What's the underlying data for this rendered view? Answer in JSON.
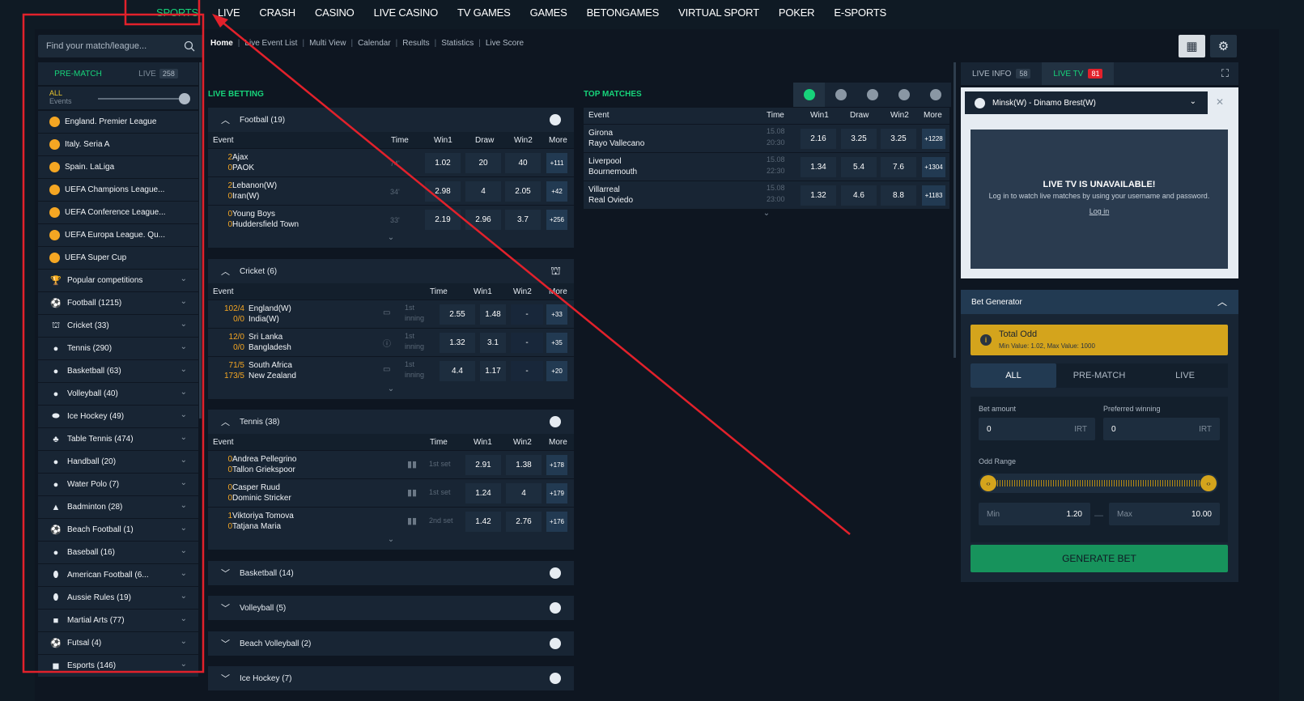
{
  "topnav": [
    "SPORTS",
    "LIVE",
    "CRASH",
    "CASINO",
    "LIVE CASINO",
    "TV GAMES",
    "GAMES",
    "BETONGAMES",
    "VIRTUAL SPORT",
    "POKER",
    "E-SPORTS"
  ],
  "search": {
    "placeholder": "Find your match/league..."
  },
  "sidebar": {
    "tabs": [
      {
        "label": "PRE-MATCH"
      },
      {
        "label": "LIVE",
        "count": "258"
      }
    ],
    "all_label": "ALL",
    "events_label": "Events",
    "items": [
      {
        "label": "England. Premier League",
        "icon": "football",
        "chev": false
      },
      {
        "label": "Italy. Seria A",
        "icon": "football",
        "chev": false
      },
      {
        "label": "Spain. LaLiga",
        "icon": "football",
        "chev": false
      },
      {
        "label": "UEFA Champions League...",
        "icon": "football",
        "chev": false
      },
      {
        "label": "UEFA Conference League...",
        "icon": "football",
        "chev": false
      },
      {
        "label": "UEFA Europa League. Qu...",
        "icon": "football",
        "chev": false
      },
      {
        "label": "UEFA Super Cup",
        "icon": "football",
        "chev": false
      },
      {
        "label": "Popular competitions",
        "icon": "podium",
        "chev": true
      },
      {
        "label": "Football (1215)",
        "icon": "soccer",
        "chev": true
      },
      {
        "label": "Cricket (33)",
        "icon": "cricket",
        "chev": true
      },
      {
        "label": "Tennis (290)",
        "icon": "tennis",
        "chev": true
      },
      {
        "label": "Basketball (63)",
        "icon": "basketball",
        "chev": true
      },
      {
        "label": "Volleyball (40)",
        "icon": "volleyball",
        "chev": true
      },
      {
        "label": "Ice Hockey (49)",
        "icon": "puck",
        "chev": true
      },
      {
        "label": "Table Tennis (474)",
        "icon": "paddle",
        "chev": true
      },
      {
        "label": "Handball (20)",
        "icon": "handball",
        "chev": true
      },
      {
        "label": "Water Polo (7)",
        "icon": "waterpolo",
        "chev": true
      },
      {
        "label": "Badminton (28)",
        "icon": "shuttle",
        "chev": true
      },
      {
        "label": "Beach Football (1)",
        "icon": "soccer",
        "chev": true
      },
      {
        "label": "Baseball (16)",
        "icon": "baseball",
        "chev": true
      },
      {
        "label": "American Football (6...",
        "icon": "amfootball",
        "chev": true
      },
      {
        "label": "Aussie Rules (19)",
        "icon": "aussie",
        "chev": true
      },
      {
        "label": "Martial Arts (77)",
        "icon": "glove",
        "chev": true
      },
      {
        "label": "Futsal (4)",
        "icon": "soccer",
        "chev": true
      },
      {
        "label": "Esports (146)",
        "icon": "gamepad",
        "chev": true
      }
    ]
  },
  "subnav": [
    "Home",
    "Live Event List",
    "Multi View",
    "Calendar",
    "Results",
    "Statistics",
    "Live Score"
  ],
  "live_betting": {
    "title": "LIVE BETTING",
    "football": {
      "label": "Football  (19)",
      "headers": {
        "event": "Event",
        "time": "Time",
        "w1": "Win1",
        "draw": "Draw",
        "w2": "Win2",
        "more": "More"
      },
      "rows": [
        {
          "s1": "2",
          "t1": "Ajax",
          "s2": "0",
          "t2": "PAOK",
          "time": "74'",
          "o1": "1.02",
          "o2": "20",
          "o3": "40",
          "more": "+111"
        },
        {
          "s1": "2",
          "t1": "Lebanon(W)",
          "s2": "0",
          "t2": "Iran(W)",
          "time": "34'",
          "o1": "2.98",
          "o2": "4",
          "o3": "2.05",
          "more": "+42"
        },
        {
          "s1": "0",
          "t1": "Young Boys",
          "s2": "0",
          "t2": "Huddersfield Town",
          "time": "33'",
          "o1": "2.19",
          "o2": "2.96",
          "o3": "3.7",
          "more": "+256"
        }
      ]
    },
    "cricket": {
      "label": "Cricket  (6)",
      "headers": {
        "event": "Event",
        "time": "Time",
        "w1": "Win1",
        "w2": "Win2",
        "more": "More"
      },
      "rows": [
        {
          "s1": "102/4",
          "t1": "England(W)",
          "s2": "0/0",
          "t2": "India(W)",
          "time1": "1st",
          "time2": "inning",
          "o1": "2.55",
          "o2": "1.48",
          "o3": "-",
          "more": "+33"
        },
        {
          "s1": "12/0",
          "t1": "Sri Lanka",
          "s2": "0/0",
          "t2": "Bangladesh",
          "time1": "1st",
          "time2": "inning",
          "o1": "1.32",
          "o2": "3.1",
          "o3": "-",
          "more": "+35"
        },
        {
          "s1": "71/5",
          "t1": "South Africa",
          "s2": "173/5",
          "t2": "New Zealand",
          "time1": "1st",
          "time2": "inning",
          "o1": "4.4",
          "o2": "1.17",
          "o3": "-",
          "more": "+20"
        }
      ]
    },
    "tennis": {
      "label": "Tennis  (38)",
      "headers": {
        "event": "Event",
        "time": "Time",
        "w1": "Win1",
        "w2": "Win2",
        "more": "More"
      },
      "rows": [
        {
          "s1": "0",
          "t1": "Andrea Pellegrino",
          "s2": "0",
          "t2": "Tallon Griekspoor",
          "time": "1st set",
          "o1": "2.91",
          "o2": "1.38",
          "more": "+178"
        },
        {
          "s1": "0",
          "t1": "Casper Ruud",
          "s2": "0",
          "t2": "Dominic Stricker",
          "time": "1st set",
          "o1": "1.24",
          "o2": "4",
          "more": "+179"
        },
        {
          "s1": "1",
          "t1": "Viktoriya Tomova",
          "s2": "0",
          "t2": "Tatjana Maria",
          "time": "2nd set",
          "o1": "1.42",
          "o2": "2.76",
          "more": "+176"
        }
      ]
    },
    "collapsed": [
      "Basketball  (14)",
      "Volleyball  (5)",
      "Beach Volleyball  (2)",
      "Ice Hockey  (7)"
    ]
  },
  "top_matches": {
    "title": "TOP MATCHES",
    "headers": {
      "event": "Event",
      "time": "Time",
      "w1": "Win1",
      "draw": "Draw",
      "w2": "Win2",
      "more": "More"
    },
    "rows": [
      {
        "t1": "Girona",
        "t2": "Rayo Vallecano",
        "date": "15.08",
        "time": "20:30",
        "o1": "2.16",
        "o2": "3.25",
        "o3": "3.25",
        "more": "+1228"
      },
      {
        "t1": "Liverpool",
        "t2": "Bournemouth",
        "date": "15.08",
        "time": "22:30",
        "o1": "1.34",
        "o2": "5.4",
        "o3": "7.6",
        "more": "+1304"
      },
      {
        "t1": "Villarreal",
        "t2": "Real Oviedo",
        "date": "15.08",
        "time": "23:00",
        "o1": "1.32",
        "o2": "4.6",
        "o3": "8.8",
        "more": "+1183"
      }
    ]
  },
  "right": {
    "tabs": [
      {
        "label": "LIVE INFO",
        "count": "58"
      },
      {
        "label": "LIVE TV",
        "count": "81"
      }
    ],
    "match": "Minsk(W) - Dinamo Brest(W)",
    "tv_title": "LIVE TV IS UNAVAILABLE!",
    "tv_text": "Log in to watch live matches by using your username and password.",
    "tv_link": "Log in",
    "bet_generator": "Bet Generator",
    "total_odd": "Total Odd",
    "total_odd_sub": "Min Value: 1.02, Max Value: 1000",
    "modes": [
      "ALL",
      "PRE-MATCH",
      "LIVE"
    ],
    "bet_amount_label": "Bet amount",
    "preferred_label": "Preferred winning",
    "bet_amount": "0",
    "preferred": "0",
    "currency": "IRT",
    "odd_range": "Odd Range",
    "min_label": "Min",
    "min_val": "1.20",
    "max_label": "Max",
    "max_val": "10.00",
    "generate": "GENERATE BET"
  },
  "annotation_color": "#e2212b"
}
